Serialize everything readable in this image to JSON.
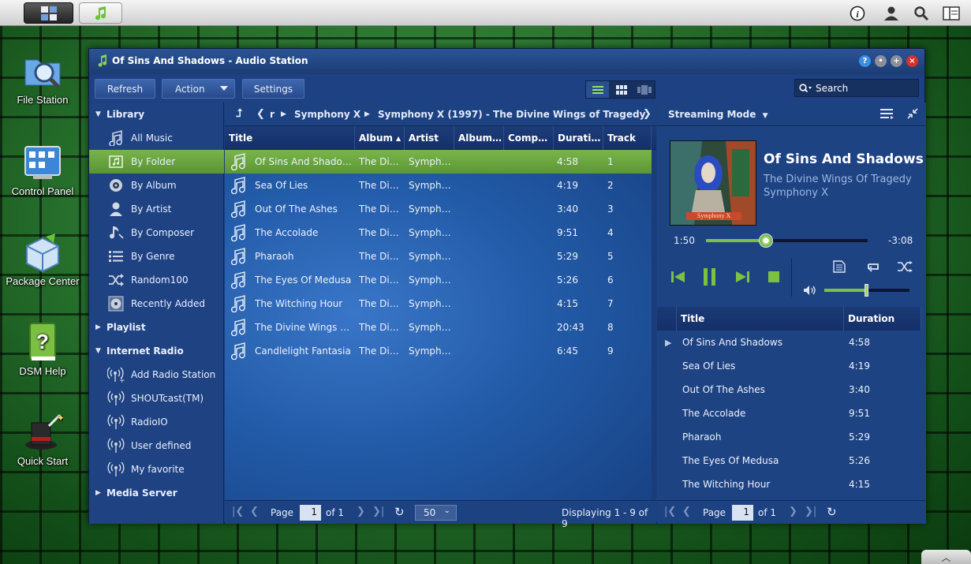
{
  "taskbar": {
    "main_menu_icon": "main-menu-icon",
    "app_icon": "music-note-icon",
    "right_icons": [
      "info-icon",
      "user-icon",
      "search-icon",
      "widgets-icon"
    ]
  },
  "desktop": {
    "icons": [
      {
        "label": "File Station",
        "icon": "magnifier-folder-icon"
      },
      {
        "label": "Control Panel",
        "icon": "control-panel-icon"
      },
      {
        "label": "Package Center",
        "icon": "package-icon"
      },
      {
        "label": "DSM Help",
        "icon": "help-book-icon"
      },
      {
        "label": "Quick Start",
        "icon": "magic-hat-icon"
      }
    ]
  },
  "window": {
    "title": "Of Sins And Shadows - Audio Station",
    "toolbar": {
      "refresh": "Refresh",
      "action": "Action",
      "settings": "Settings",
      "search_placeholder": "Search"
    },
    "sidebar": {
      "library": "Library",
      "library_items": [
        {
          "label": "All Music",
          "icon": "music-note-icon"
        },
        {
          "label": "By Folder",
          "icon": "folder-note-icon"
        },
        {
          "label": "By Album",
          "icon": "disc-icon"
        },
        {
          "label": "By Artist",
          "icon": "person-icon"
        },
        {
          "label": "By Composer",
          "icon": "composer-icon"
        },
        {
          "label": "By Genre",
          "icon": "list-icon"
        },
        {
          "label": "Random100",
          "icon": "shuffle-icon"
        },
        {
          "label": "Recently Added",
          "icon": "recent-disc-icon"
        }
      ],
      "playlist": "Playlist",
      "internet_radio": "Internet Radio",
      "radio_items": [
        {
          "label": "Add Radio Station"
        },
        {
          "label": "SHOUTcast(TM)"
        },
        {
          "label": "RadioIO"
        },
        {
          "label": "User defined"
        },
        {
          "label": "My favorite"
        }
      ],
      "media_server": "Media Server"
    },
    "breadcrumb": {
      "root": "r",
      "items": [
        "Symphony X",
        "Symphony X (1997) - The Divine Wings of Tragedy"
      ]
    },
    "columns": [
      "Title",
      "Album",
      "Artist",
      "Album…",
      "Comp…",
      "Durati…",
      "Track"
    ],
    "tracks": [
      {
        "title": "Of Sins And Shado…",
        "album": "The Di…",
        "artist": "Symph…",
        "duration": "4:58",
        "track": "1"
      },
      {
        "title": "Sea Of Lies",
        "album": "The Di…",
        "artist": "Symph…",
        "duration": "4:19",
        "track": "2"
      },
      {
        "title": "Out Of The Ashes",
        "album": "The Di…",
        "artist": "Symph…",
        "duration": "3:40",
        "track": "3"
      },
      {
        "title": "The Accolade",
        "album": "The Di…",
        "artist": "Symph…",
        "duration": "9:51",
        "track": "4"
      },
      {
        "title": "Pharaoh",
        "album": "The Di…",
        "artist": "Symph…",
        "duration": "5:29",
        "track": "5"
      },
      {
        "title": "The Eyes Of Medusa",
        "album": "The Di…",
        "artist": "Symph…",
        "duration": "5:26",
        "track": "6"
      },
      {
        "title": "The Witching Hour",
        "album": "The Di…",
        "artist": "Symph…",
        "duration": "4:15",
        "track": "7"
      },
      {
        "title": "The Divine Wings …",
        "album": "The Di…",
        "artist": "Symph…",
        "duration": "20:43",
        "track": "8"
      },
      {
        "title": "Candlelight Fantasia",
        "album": "The Di…",
        "artist": "Symph…",
        "duration": "6:45",
        "track": "9"
      }
    ],
    "pager": {
      "page_label": "Page",
      "page": "1",
      "of": "of 1",
      "per_page": "50",
      "displaying": "Displaying 1 - 9 of 9"
    },
    "player": {
      "mode": "Streaming Mode",
      "now_title": "Of Sins And Shadows",
      "now_album": "The Divine Wings Of Tragedy",
      "now_artist": "Symphony X",
      "elapsed": "1:50",
      "remaining": "-3:08",
      "progress": 0.37,
      "volume": 0.5,
      "playlist_columns": [
        "Title",
        "Duration"
      ],
      "playlist": [
        {
          "title": "Of Sins And Shadows",
          "duration": "4:58"
        },
        {
          "title": "Sea Of Lies",
          "duration": "4:19"
        },
        {
          "title": "Out Of The Ashes",
          "duration": "3:40"
        },
        {
          "title": "The Accolade",
          "duration": "9:51"
        },
        {
          "title": "Pharaoh",
          "duration": "5:29"
        },
        {
          "title": "The Eyes Of Medusa",
          "duration": "5:26"
        },
        {
          "title": "The Witching Hour",
          "duration": "4:15"
        }
      ],
      "pager": {
        "page_label": "Page",
        "page": "1",
        "of": "of 1"
      }
    }
  },
  "colors": {
    "accent_green": "#6aa83f",
    "window_blue": "#1b3f7e"
  }
}
